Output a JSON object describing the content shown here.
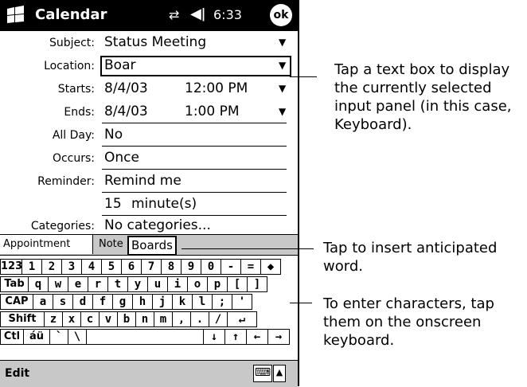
{
  "status_bar": {
    "title": "Calendar",
    "signal_icon": "signal-icon",
    "volume_icon": "volume-icon",
    "time": "6:33",
    "ok_label": "ok"
  },
  "form": {
    "subject": {
      "label": "Subject:",
      "value": "Status Meeting"
    },
    "location": {
      "label": "Location:",
      "value": "Boar"
    },
    "starts": {
      "label": "Starts:",
      "date": "8/4/03",
      "time": "12:00 PM"
    },
    "ends": {
      "label": "Ends:",
      "date": "8/4/03",
      "time": "1:00 PM"
    },
    "all_day": {
      "label": "All Day:",
      "value": "No"
    },
    "occurs": {
      "label": "Occurs:",
      "value": "Once"
    },
    "reminder": {
      "label": "Reminder:",
      "value": "Remind me",
      "amount": "15",
      "unit": "minute(s)"
    },
    "categories": {
      "label": "Categories:",
      "value": "No categories..."
    }
  },
  "tabs": {
    "appointment": "Appointment",
    "notes": "Note",
    "suggestion": "Boards"
  },
  "keyboard": {
    "row1": [
      "123",
      "1",
      "2",
      "3",
      "4",
      "5",
      "6",
      "7",
      "8",
      "9",
      "0",
      "-",
      "=",
      "◆"
    ],
    "row2": [
      "Tab",
      "q",
      "w",
      "e",
      "r",
      "t",
      "y",
      "u",
      "i",
      "o",
      "p",
      "[",
      "]"
    ],
    "row3": [
      "CAP",
      "a",
      "s",
      "d",
      "f",
      "g",
      "h",
      "j",
      "k",
      "l",
      ";",
      "'"
    ],
    "row4": [
      "Shift",
      "z",
      "x",
      "c",
      "v",
      "b",
      "n",
      "m",
      ",",
      ".",
      "/",
      "↵"
    ],
    "row5": [
      "Ctl",
      "áü",
      "`",
      "\\",
      "",
      "↓",
      "↑",
      "←",
      "→"
    ]
  },
  "menubar": {
    "edit": "Edit",
    "keyboard_icon": "keyboard-icon",
    "sip_arrow": "▲"
  },
  "callouts": [
    "Tap a text box to display the currently selected input panel (in this case, Keyboard).",
    "Tap to insert anticipated word.",
    "To enter characters, tap them on the onscreen keyboard."
  ]
}
